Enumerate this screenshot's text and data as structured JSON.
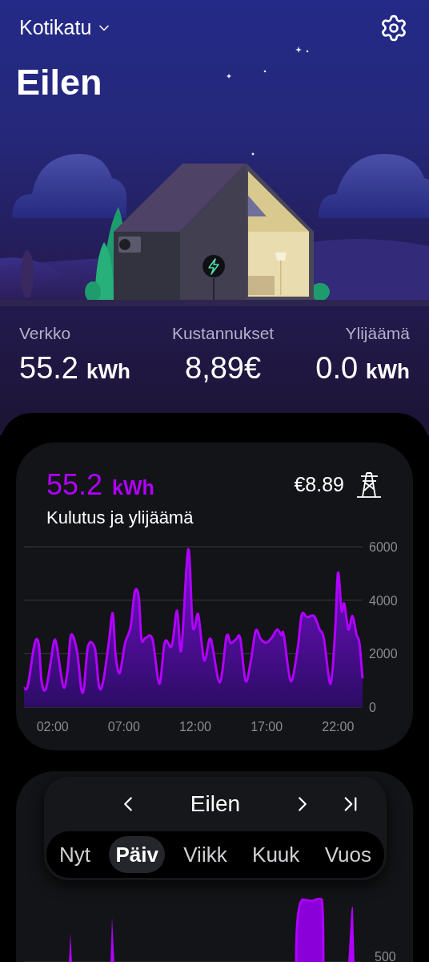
{
  "header": {
    "location": "Kotikatu",
    "title": "Eilen"
  },
  "stats": [
    {
      "label": "Verkko",
      "value": "55.2",
      "unit": "kWh"
    },
    {
      "label": "Kustannukset",
      "value": "8,89€"
    },
    {
      "label": "Ylijäämä",
      "value": "0.0",
      "unit": "kWh"
    }
  ],
  "usage_card": {
    "value": "55.2",
    "unit": "kWh",
    "subtitle": "Kulutus ja ylijäämä",
    "cost": "€8.89",
    "chart_data": {
      "type": "area",
      "xlim": [
        0,
        23.72
      ],
      "ylim": [
        0,
        6000
      ],
      "yticks": [
        0,
        2000,
        4000,
        6000
      ],
      "xticks": [
        {
          "value": 2,
          "label": "02:00"
        },
        {
          "value": 7,
          "label": "07:00"
        },
        {
          "value": 12,
          "label": "12:00"
        },
        {
          "value": 17,
          "label": "17:00"
        },
        {
          "value": 22,
          "label": "22:00"
        }
      ],
      "x": [
        0,
        0.27,
        0.75,
        1.04,
        1.23,
        1.52,
        1.9,
        2.09,
        2.28,
        2.76,
        3.05,
        3.3,
        3.72,
        4.0,
        4.2,
        4.49,
        4.97,
        5.26,
        5.55,
        5.93,
        6.22,
        6.41,
        6.7,
        7.08,
        7.47,
        7.76,
        8.04,
        8.23,
        8.52,
        9.0,
        9.48,
        9.87,
        10.35,
        10.73,
        11.02,
        11.5,
        11.79,
        11.98,
        12.21,
        12.56,
        12.75,
        13.09,
        13.71,
        14.19,
        14.48,
        14.86,
        15.15,
        15.53,
        15.91,
        16.24,
        16.59,
        16.97,
        17.35,
        17.74,
        18.02,
        18.2,
        18.69,
        19.17,
        19.46,
        19.84,
        20.32,
        20.71,
        21.0,
        21.48,
        21.8,
        22.0,
        22.25,
        22.44,
        22.73,
        23.01,
        23.3,
        23.5,
        23.72
      ],
      "series": [
        {
          "color": "#b000ff",
          "values": [
            710,
            810,
            2390,
            2340,
            970,
            660,
            1780,
            2440,
            2340,
            760,
            1370,
            2700,
            2080,
            710,
            710,
            2290,
            2190,
            760,
            970,
            2390,
            3510,
            1980,
            1270,
            2390,
            3000,
            4320,
            4120,
            2540,
            2590,
            2540,
            870,
            2440,
            2290,
            3610,
            2140,
            5900,
            3200,
            3000,
            3460,
            1880,
            1880,
            2540,
            920,
            2640,
            2390,
            2540,
            2570,
            970,
            1780,
            2870,
            2540,
            2410,
            2590,
            2900,
            2700,
            2700,
            970,
            2190,
            3460,
            3360,
            3410,
            2900,
            2590,
            870,
            2900,
            5030,
            3610,
            3870,
            2900,
            3410,
            2700,
            2390,
            1070
          ]
        }
      ]
    }
  },
  "second_card": {
    "axis_label": "500"
  },
  "period_picker": {
    "title": "Eilen",
    "tabs": [
      {
        "label": "Nyt",
        "selected": false
      },
      {
        "label": "Päiv",
        "selected": true
      },
      {
        "label": "Viikk",
        "selected": false
      },
      {
        "label": "Kuuk",
        "selected": false
      },
      {
        "label": "Vuos",
        "selected": false
      }
    ]
  }
}
